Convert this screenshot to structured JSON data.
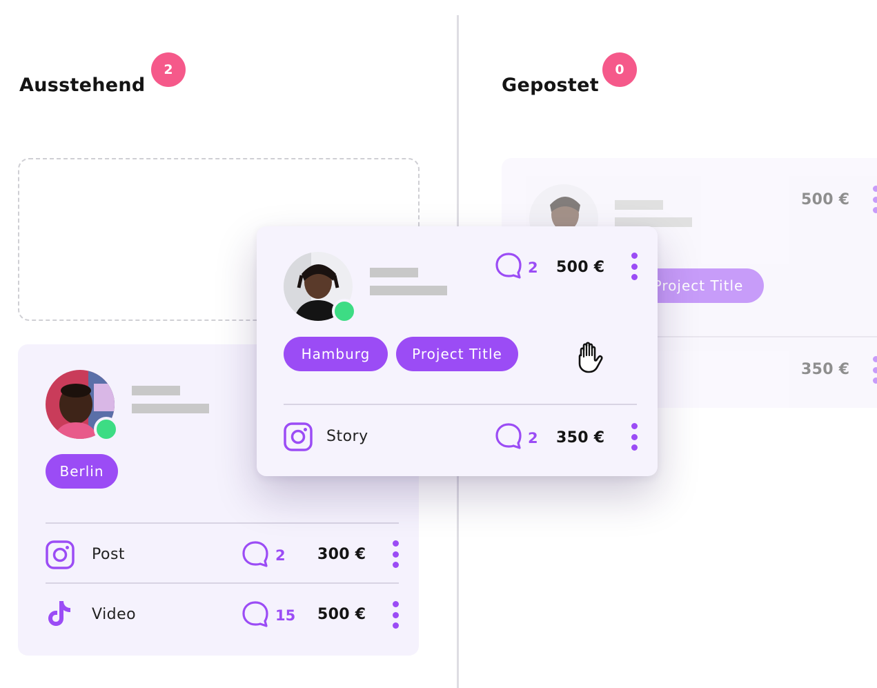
{
  "colors": {
    "accent": "#9b4cf5",
    "badge": "#f5598a",
    "online": "#3ddc84",
    "card_bg": "#f5f2fd"
  },
  "columns": [
    {
      "title": "Ausstehend",
      "count": "2"
    },
    {
      "title": "Gepostet",
      "count": "0"
    }
  ],
  "card_pending": {
    "tags": [
      "Berlin"
    ],
    "rows": [
      {
        "platform": "instagram-icon",
        "label": "Post",
        "comments": "2",
        "price": "300 €"
      },
      {
        "platform": "tiktok-icon",
        "label": "Video",
        "comments": "15",
        "price": "500 €"
      }
    ]
  },
  "card_dragged": {
    "comments": "2",
    "price": "500 €",
    "tags": [
      "Hamburg",
      "Project Title"
    ],
    "rows": [
      {
        "platform": "instagram-icon",
        "label": "Story",
        "comments": "2",
        "price": "350 €"
      }
    ],
    "cursor": "grab-hand-icon"
  },
  "card_posted": {
    "price": "500 €",
    "tags": [
      "Project Title"
    ],
    "rows": [
      {
        "price": "350 €"
      }
    ]
  }
}
